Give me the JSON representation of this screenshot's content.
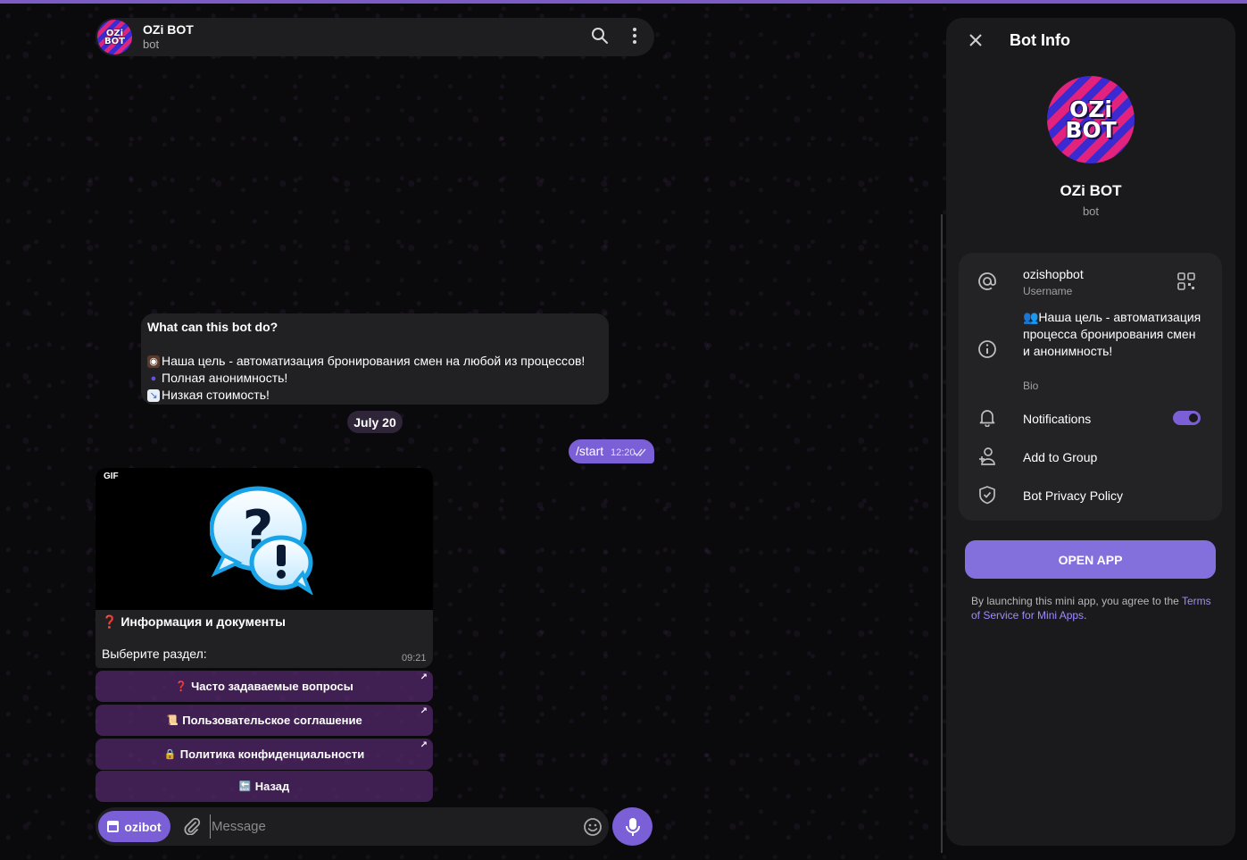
{
  "header": {
    "title": "OZi BOT",
    "subtitle": "bot",
    "avatar_text": "OZi BOT"
  },
  "bot_description": {
    "title": "What can this bot do?",
    "lines": [
      "Наша цель - автоматизация бронирования смен на любой из процессов!",
      "Полная анонимность!",
      "Низкая стоимость!"
    ]
  },
  "date_chip": "July 20",
  "outgoing": {
    "text": "/start",
    "time": "12:20"
  },
  "gif_message": {
    "badge": "GIF",
    "caption_title": "Информация и документы",
    "caption_body": "Выберите раздел:",
    "time": "09:21"
  },
  "keyboard": [
    {
      "label": "Часто задаваемые вопросы",
      "emoji": "❓",
      "emoji_color": "#e0202a",
      "external": true
    },
    {
      "label": "Пользовательское соглашение",
      "emoji": "📜",
      "emoji_color": "#c9a064",
      "external": true
    },
    {
      "label": "Политика конфиденциальности",
      "emoji": "🔒",
      "emoji_color": "#e7b83e",
      "external": true
    },
    {
      "label": "Назад",
      "emoji": "🔙",
      "emoji_color": "#4a4a4a",
      "external": false
    }
  ],
  "composer": {
    "bot_button": "ozibot",
    "placeholder": "Message"
  },
  "panel": {
    "title": "Bot Info",
    "name": "OZi BOT",
    "subtitle": "bot",
    "avatar_text": "OZi BOT",
    "username": "ozishopbot",
    "username_label": "Username",
    "bio": "👥Наша цель - автоматизация процесса бронирования смен и анонимность!",
    "bio_label": "Bio",
    "notifications_label": "Notifications",
    "notifications_on": true,
    "add_to_group": "Add to Group",
    "privacy_policy": "Bot Privacy Policy",
    "open_app": "OPEN APP",
    "terms_prefix": "By launching this mini app, you agree to the",
    "terms_link": "Terms of Service for Mini Apps",
    "terms_suffix": "."
  },
  "colors": {
    "accent": "#7a5fd6",
    "bubble": "#212123",
    "panel": "#1a1a1c"
  }
}
